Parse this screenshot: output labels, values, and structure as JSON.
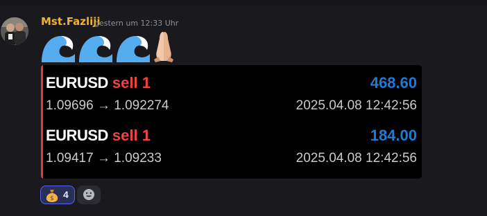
{
  "message": {
    "author": "Mst.Fazliji",
    "timestamp": "gestern um 12:33 Uhr",
    "emoji_content": [
      "wave-emoji",
      "wave-emoji",
      "wave-emoji",
      "folded-hands-emoji"
    ]
  },
  "embed": {
    "accent_color": "#e03a3e",
    "trades": [
      {
        "pair": "EURUSD",
        "side": "sell 1",
        "pnl": "468.60",
        "prices": "1.09696 → 1.092274",
        "time": "2025.04.08 12:42:56"
      },
      {
        "pair": "EURUSD",
        "side": "sell 1",
        "pnl": "184.00",
        "prices": "1.09417 → 1.09233",
        "time": "2025.04.08 12:42:56"
      }
    ]
  },
  "reactions": [
    {
      "emoji": "money-bag-emoji",
      "count": "4",
      "selected": true
    }
  ],
  "add_reaction_icon": "smiley-add-reaction-icon"
}
